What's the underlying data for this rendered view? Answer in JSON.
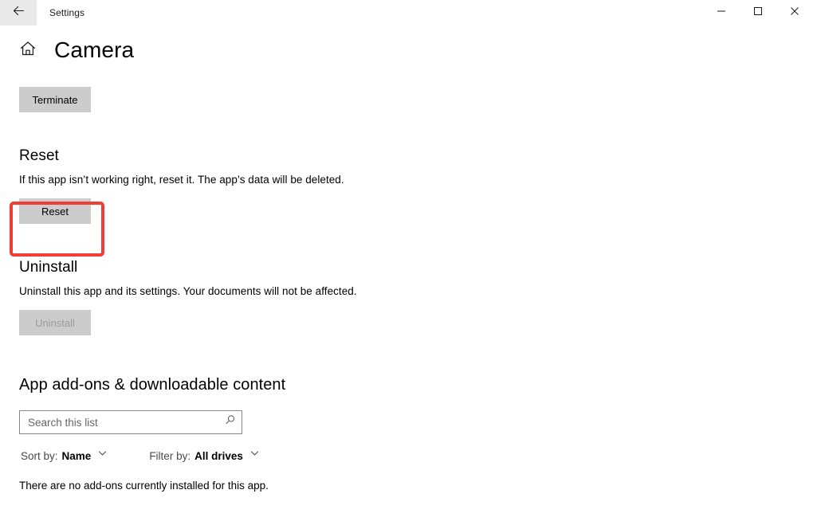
{
  "window": {
    "app_title": "Settings",
    "back_icon": "back-arrow-icon",
    "minimize_icon": "minimize-icon",
    "maximize_icon": "maximize-icon",
    "close_icon": "close-icon"
  },
  "header": {
    "home_icon": "home-icon",
    "title": "Camera"
  },
  "terminate": {
    "button_label": "Terminate"
  },
  "reset": {
    "heading": "Reset",
    "description": "If this app isn’t working right, reset it. The app’s data will be deleted.",
    "button_label": "Reset",
    "highlight_color": "#ef3e36"
  },
  "uninstall": {
    "heading": "Uninstall",
    "description": "Uninstall this app and its settings. Your documents will not be affected.",
    "button_label": "Uninstall",
    "button_disabled": "true"
  },
  "addons": {
    "heading": "App add-ons & downloadable content",
    "search": {
      "value": "",
      "placeholder": "Search this list",
      "icon": "search-icon"
    },
    "sort": {
      "label": "Sort by:",
      "value": "Name",
      "chevron_icon": "chevron-down-icon"
    },
    "filter": {
      "label": "Filter by:",
      "value": "All drives",
      "chevron_icon": "chevron-down-icon"
    },
    "empty_message": "There are no add-ons currently installed for this app."
  }
}
